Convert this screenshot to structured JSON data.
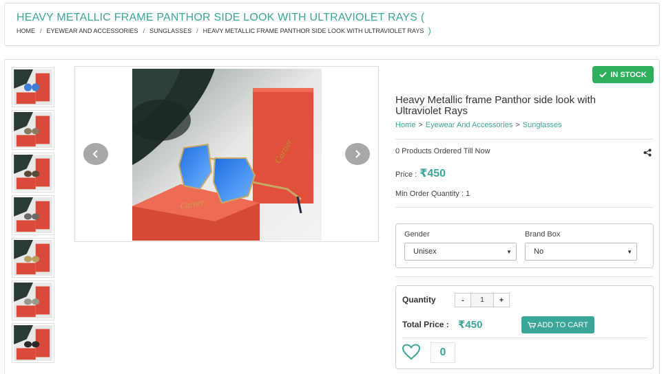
{
  "header": {
    "title": "HEAVY METALLIC FRAME PANTHOR SIDE LOOK WITH ULTRAVIOLET RAYS (",
    "breadcrumb": [
      "HOME",
      "EYEWEAR AND ACCESSORIES",
      "SUNGLASSES",
      "HEAVY METALLIC FRAME PANTHOR SIDE LOOK WITH ULTRAVIOLET RAYS"
    ],
    "breadcrumb_close": ")",
    "separator": "/"
  },
  "gallery": {
    "thumbnail_count": 7,
    "prev_icon": "chevron-left-icon",
    "next_icon": "chevron-right-icon",
    "box_brand": "Cartier"
  },
  "product": {
    "stock_badge": "IN STOCK",
    "title": "Heavy Metallic frame Panthor side look with Ultraviolet Rays",
    "crumbs": [
      "Home",
      "Eyewear And Accessories",
      "Sunglasses"
    ],
    "crumb_separator": ">",
    "ordered_text": "0 Products Ordered Till Now",
    "price_label": "Price :",
    "price_value": "₹450",
    "min_order": "Min Order Quantity : 1"
  },
  "options": {
    "gender_label": "Gender",
    "gender_value": "Unisex",
    "brandbox_label": "Brand Box",
    "brandbox_value": "No"
  },
  "cart": {
    "quantity_label": "Quantity",
    "minus": "-",
    "quantity": "1",
    "plus": "+",
    "total_label": "Total Price :",
    "total_value": "₹450",
    "add_to_cart": "ADD TO CART",
    "wishlist_count": "0"
  },
  "colors": {
    "accent": "#3aa699",
    "stock_green": "#2daf5b"
  }
}
